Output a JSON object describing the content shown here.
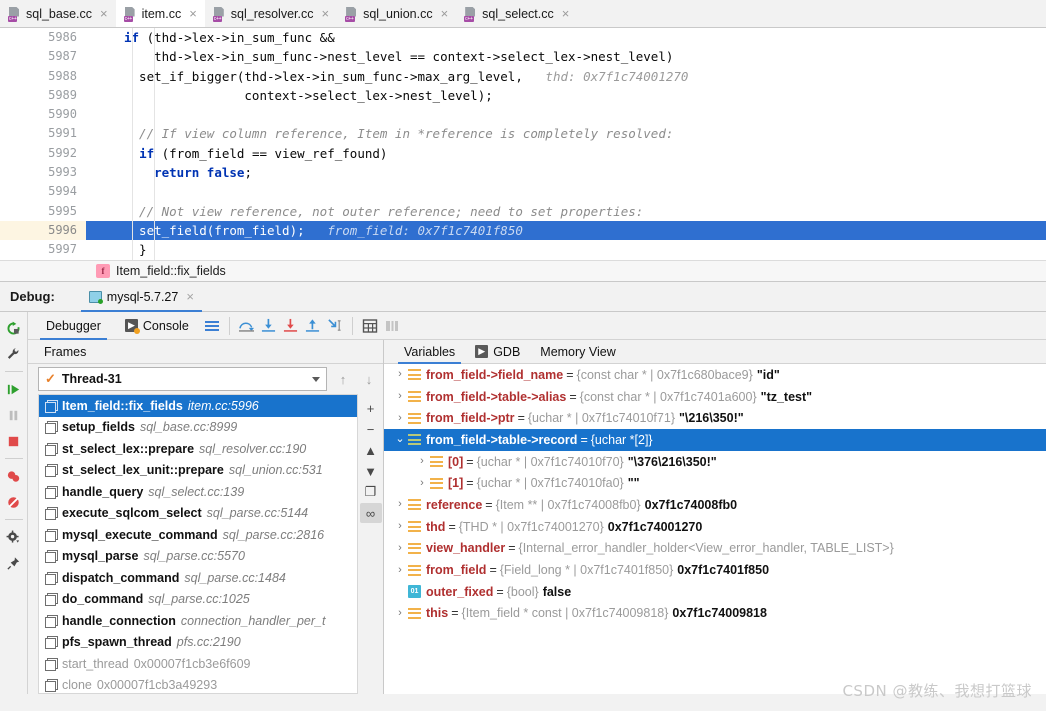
{
  "editor_tabs": [
    {
      "label": "sql_base.cc",
      "active": false
    },
    {
      "label": "item.cc",
      "active": true
    },
    {
      "label": "sql_resolver.cc",
      "active": false
    },
    {
      "label": "sql_union.cc",
      "active": false
    },
    {
      "label": "sql_select.cc",
      "active": false
    }
  ],
  "code": {
    "lines": [
      {
        "num": "5986",
        "current": false,
        "highlight": false,
        "indent": 0,
        "parts": [
          {
            "t": "if",
            "c": "kw"
          },
          {
            "t": " (thd->lex->in_sum_func &&",
            "c": ""
          }
        ]
      },
      {
        "num": "5987",
        "current": false,
        "highlight": false,
        "indent": 4,
        "parts": [
          {
            "t": "    thd->lex->in_sum_func->nest_level == context->select_lex->nest_level)",
            "c": ""
          }
        ]
      },
      {
        "num": "5988",
        "current": false,
        "highlight": false,
        "indent": 2,
        "parts": [
          {
            "t": "  set_if_bigger(thd->lex->in_sum_func->max_arg_level,",
            "c": ""
          },
          {
            "t": "   thd: 0x7f1c74001270",
            "c": "hint"
          }
        ]
      },
      {
        "num": "5989",
        "current": false,
        "highlight": false,
        "indent": 0,
        "parts": [
          {
            "t": "                context->select_lex->nest_level);",
            "c": ""
          }
        ]
      },
      {
        "num": "5990",
        "current": false,
        "highlight": false,
        "indent": 0,
        "parts": [
          {
            "t": "",
            "c": ""
          }
        ]
      },
      {
        "num": "5991",
        "current": false,
        "highlight": false,
        "indent": 0,
        "parts": [
          {
            "t": "  // If view column reference, Item in *reference is completely resolved:",
            "c": "cmt"
          }
        ]
      },
      {
        "num": "5992",
        "current": false,
        "highlight": false,
        "indent": 0,
        "parts": [
          {
            "t": "  ",
            "c": ""
          },
          {
            "t": "if",
            "c": "kw"
          },
          {
            "t": " (from_field == view_ref_found)",
            "c": ""
          }
        ]
      },
      {
        "num": "5993",
        "current": false,
        "highlight": false,
        "indent": 0,
        "parts": [
          {
            "t": "    ",
            "c": ""
          },
          {
            "t": "return",
            "c": "kw"
          },
          {
            "t": " ",
            "c": ""
          },
          {
            "t": "false",
            "c": "kw"
          },
          {
            "t": ";",
            "c": ""
          }
        ]
      },
      {
        "num": "5994",
        "current": false,
        "highlight": false,
        "indent": 0,
        "parts": [
          {
            "t": "",
            "c": ""
          }
        ]
      },
      {
        "num": "5995",
        "current": false,
        "highlight": false,
        "indent": 0,
        "parts": [
          {
            "t": "  // Not view reference, not outer reference; need to set properties:",
            "c": "cmt"
          }
        ]
      },
      {
        "num": "5996",
        "current": true,
        "highlight": true,
        "indent": 0,
        "parts": [
          {
            "t": "  set_field(from_field);",
            "c": ""
          },
          {
            "t": "   from_field: 0x7f1c7401f850",
            "c": "hint"
          }
        ]
      },
      {
        "num": "5997",
        "current": false,
        "highlight": false,
        "indent": 0,
        "parts": [
          {
            "t": "  }",
            "c": ""
          }
        ]
      }
    ]
  },
  "breadcrumb": {
    "icon": "function-icon",
    "icon_glyph": "f",
    "label": "Item_field::fix_fields"
  },
  "debug_header": {
    "label": "Debug:",
    "session": "mysql-5.7.27",
    "close": "×"
  },
  "left_rail": [
    {
      "name": "rerun-icon"
    },
    {
      "name": "settings-wrench-icon"
    },
    {
      "name": "resume-program-icon"
    },
    {
      "name": "pause-program-icon"
    },
    {
      "name": "stop-icon"
    },
    {
      "name": "view-breakpoints-icon"
    },
    {
      "name": "mute-breakpoints-icon"
    },
    {
      "name": "settings-gear-icon"
    },
    {
      "name": "pin-tab-icon"
    }
  ],
  "debug_tabs": [
    {
      "label": "Debugger",
      "active": true,
      "icon": null
    },
    {
      "label": "Console",
      "active": false,
      "icon": "console-icon"
    }
  ],
  "debug_toolbar": [
    {
      "name": "layout-settings-icon"
    },
    {
      "name": "step-over-icon"
    },
    {
      "name": "step-into-icon"
    },
    {
      "name": "force-step-into-icon"
    },
    {
      "name": "step-out-icon"
    },
    {
      "name": "run-to-cursor-icon"
    },
    {
      "name": "evaluate-expression-icon"
    },
    {
      "name": "show-values-inline-icon"
    }
  ],
  "frames": {
    "pane_title": "Frames",
    "thread": {
      "label": "Thread-31",
      "check": "✓"
    },
    "up_arrow": "↑",
    "down_arrow": "↓",
    "rail": [
      {
        "name": "add-frame-icon",
        "glyph": "+",
        "on": false
      },
      {
        "name": "remove-frame-icon",
        "glyph": "−",
        "on": false
      },
      {
        "name": "move-up-icon",
        "glyph": "▲",
        "on": false
      },
      {
        "name": "move-down-icon",
        "glyph": "▼",
        "on": false
      },
      {
        "name": "copy-stack-icon",
        "glyph": "❐",
        "on": false
      },
      {
        "name": "customize-threads-icon",
        "glyph": "∞",
        "on": true
      }
    ],
    "items": [
      {
        "name": "Item_field::fix_fields",
        "loc": "item.cc:5996",
        "selected": true,
        "dim": false
      },
      {
        "name": "setup_fields",
        "loc": "sql_base.cc:8999",
        "selected": false,
        "dim": false
      },
      {
        "name": "st_select_lex::prepare",
        "loc": "sql_resolver.cc:190",
        "selected": false,
        "dim": false
      },
      {
        "name": "st_select_lex_unit::prepare",
        "loc": "sql_union.cc:531",
        "selected": false,
        "dim": false
      },
      {
        "name": "handle_query",
        "loc": "sql_select.cc:139",
        "selected": false,
        "dim": false
      },
      {
        "name": "execute_sqlcom_select",
        "loc": "sql_parse.cc:5144",
        "selected": false,
        "dim": false
      },
      {
        "name": "mysql_execute_command",
        "loc": "sql_parse.cc:2816",
        "selected": false,
        "dim": false
      },
      {
        "name": "mysql_parse",
        "loc": "sql_parse.cc:5570",
        "selected": false,
        "dim": false
      },
      {
        "name": "dispatch_command",
        "loc": "sql_parse.cc:1484",
        "selected": false,
        "dim": false
      },
      {
        "name": "do_command",
        "loc": "sql_parse.cc:1025",
        "selected": false,
        "dim": false
      },
      {
        "name": "handle_connection",
        "loc": "connection_handler_per_t",
        "selected": false,
        "dim": false
      },
      {
        "name": "pfs_spawn_thread",
        "loc": "pfs.cc:2190",
        "selected": false,
        "dim": false
      },
      {
        "name": "start_thread",
        "loc": "0x00007f1cb3e6f609",
        "selected": false,
        "dim": true
      },
      {
        "name": "clone",
        "loc": "0x00007f1cb3a49293",
        "selected": false,
        "dim": true
      }
    ]
  },
  "variables": {
    "tabs": [
      {
        "label": "Variables",
        "active": true,
        "icon": null
      },
      {
        "label": "GDB",
        "active": false,
        "icon": "gdb-icon",
        "icon_glyph": "▶"
      },
      {
        "label": "Memory View",
        "active": false,
        "icon": null
      }
    ],
    "rows": [
      {
        "indent": 0,
        "toggle": ">",
        "icon": "array-icon",
        "name": "from_field->field_name",
        "type": "{const char * | 0x7f1c680bace9}",
        "value": "\"id\"",
        "selected": false
      },
      {
        "indent": 0,
        "toggle": ">",
        "icon": "array-icon",
        "name": "from_field->table->alias",
        "type": "{const char * | 0x7f1c7401a600}",
        "value": "\"tz_test\"",
        "selected": false
      },
      {
        "indent": 0,
        "toggle": ">",
        "icon": "array-icon",
        "name": "from_field->ptr",
        "type": "{uchar * | 0x7f1c74010f71}",
        "value": "\"\\216\\350!\"",
        "selected": false
      },
      {
        "indent": 0,
        "toggle": "v",
        "icon": "array-icon",
        "name": "from_field->table->record",
        "type": "{uchar *[2]}",
        "value": "",
        "selected": true
      },
      {
        "indent": 1,
        "toggle": ">",
        "icon": "array-icon",
        "name": "[0]",
        "type": "{uchar * | 0x7f1c74010f70}",
        "value": "\"\\376\\216\\350!\"",
        "selected": false
      },
      {
        "indent": 1,
        "toggle": ">",
        "icon": "array-icon",
        "name": "[1]",
        "type": "{uchar * | 0x7f1c74010fa0}",
        "value": "\"\"",
        "selected": false
      },
      {
        "indent": 0,
        "toggle": ">",
        "icon": "array-icon",
        "name": "reference",
        "type": "{Item ** | 0x7f1c74008fb0}",
        "value": "0x7f1c74008fb0",
        "selected": false
      },
      {
        "indent": 0,
        "toggle": ">",
        "icon": "array-icon",
        "name": "thd",
        "type": "{THD * | 0x7f1c74001270}",
        "value": "0x7f1c74001270",
        "selected": false
      },
      {
        "indent": 0,
        "toggle": ">",
        "icon": "array-icon",
        "name": "view_handler",
        "type": "{Internal_error_handler_holder<View_error_handler, TABLE_LIST>}",
        "value": "",
        "selected": false
      },
      {
        "indent": 0,
        "toggle": ">",
        "icon": "array-icon",
        "name": "from_field",
        "type": "{Field_long * | 0x7f1c7401f850}",
        "value": "0x7f1c7401f850",
        "selected": false
      },
      {
        "indent": 0,
        "toggle": "",
        "icon": "bool-icon",
        "name": "outer_fixed",
        "type": "{bool}",
        "value": "false",
        "selected": false
      },
      {
        "indent": 0,
        "toggle": ">",
        "icon": "array-icon",
        "name": "this",
        "type": "{Item_field * const | 0x7f1c74009818}",
        "value": "0x7f1c74009818",
        "selected": false
      }
    ]
  },
  "watermark": "CSDN @教练、我想打篮球",
  "colors": {
    "selection_blue": "#1873cc",
    "code_highlight": "#2f6fd0",
    "accent": "#3b7fd4",
    "keyword": "#0033b3",
    "comment": "#8c8c8c",
    "var_name": "#871094",
    "current_line_gutter": "#fdf5e2"
  }
}
